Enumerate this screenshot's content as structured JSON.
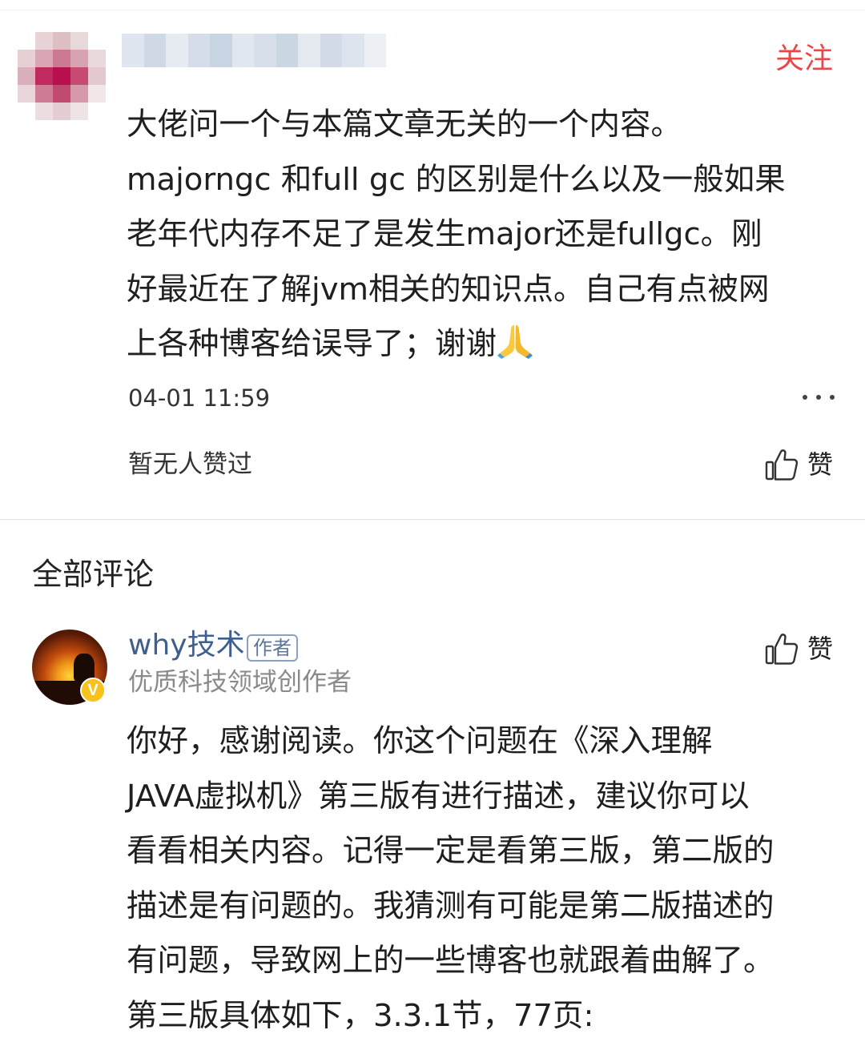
{
  "first_comment": {
    "follow_label": "关注",
    "text_lines": [
      "大佬问一个与本篇文章无关的一个内容。",
      "majorngc 和full gc 的区别是什么以及一般如果",
      "老年代内存不足了是发生major还是fullgc。刚",
      "好最近在了解jvm相关的知识点。自己有点被网",
      "上各种博客给误导了；谢谢"
    ],
    "emoji_icon": "folded-hands-icon",
    "timestamp": "04-01 11:59",
    "likes_text": "暂无人赞过",
    "like_label": "赞"
  },
  "all_comments": {
    "title": "全部评论"
  },
  "reply": {
    "author_name": "why技术",
    "author_badge": "作者",
    "author_subtitle": "优质科技领域创作者",
    "verified_mark": "V",
    "like_label": "赞",
    "text_lines": [
      "你好，感谢阅读。你这个问题在《深入理解",
      "JAVA虚拟机》第三版有进行描述，建议你可以",
      "看看相关内容。记得一定是看第三版，第二版的",
      "描述是有问题的。我猜测有可能是第二版描述的",
      "有问题，导致网上的一些博客也就跟着曲解了。",
      "第三版具体如下，3.3.1节，77页:"
    ]
  },
  "colors": {
    "follow": "#e8484a",
    "author_name": "#3f5f8c",
    "subtitle": "#8a8a8a",
    "verified": "#f7c21b"
  }
}
